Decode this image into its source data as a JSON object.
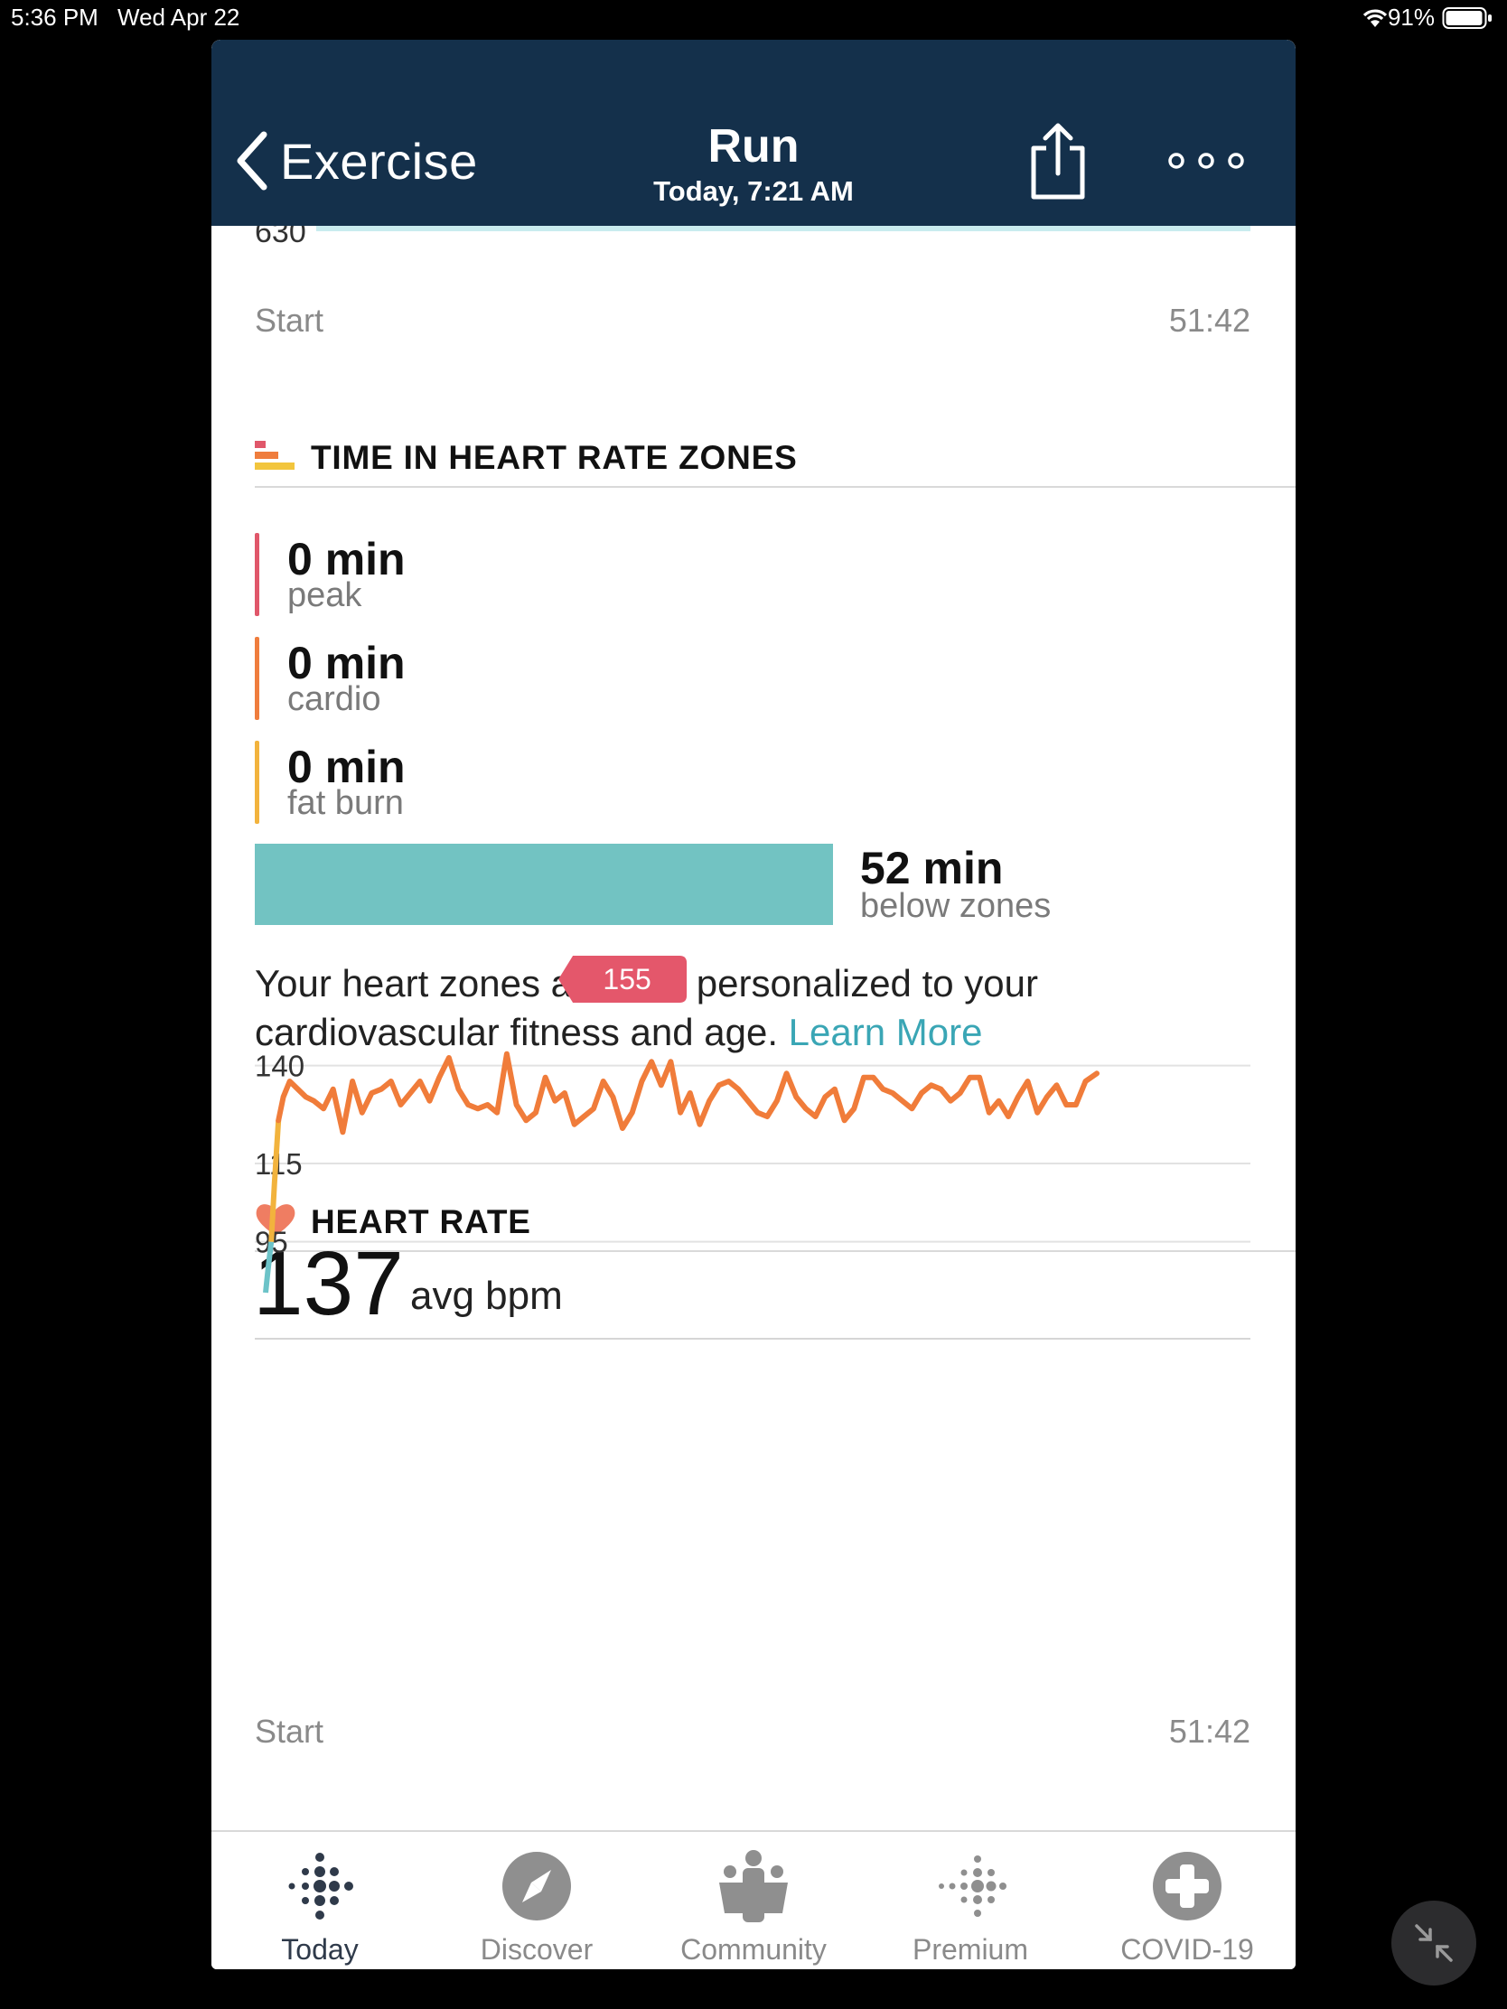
{
  "status_bar": {
    "time": "5:36 PM",
    "date": "Wed Apr 22",
    "battery": "91%"
  },
  "header": {
    "back_label": "Exercise",
    "title": "Run",
    "subtitle": "Today, 7:21 AM"
  },
  "top_chart": {
    "y_label": "630",
    "x_start": "Start",
    "x_end": "51:42"
  },
  "zones_section": {
    "title": "TIME IN HEART RATE ZONES",
    "zones": [
      {
        "value": "0 min",
        "label": "peak",
        "color": "#e0576a"
      },
      {
        "value": "0 min",
        "label": "cardio",
        "color": "#ef7d3d"
      },
      {
        "value": "0 min",
        "label": "fat burn",
        "color": "#f2b33d"
      }
    ],
    "below": {
      "value": "52 min",
      "label": "below zones",
      "color": "#72c3c2"
    },
    "note": "Your heart zones are now personalized to your cardiovascular fitness and age.",
    "learn_more": "Learn More"
  },
  "heart_rate_section": {
    "title": "HEART RATE",
    "avg_value": "137",
    "avg_unit": "avg bpm"
  },
  "chart_data": {
    "type": "line",
    "y_ticks": [
      140,
      115,
      95
    ],
    "ylim": [
      70,
      160
    ],
    "xlim": [
      0,
      51.7
    ],
    "x_start_label": "Start",
    "x_end_label": "51:42",
    "peak_label": "155",
    "peak_x": 19.0,
    "series": [
      {
        "x": [
          0,
          0.15,
          0.35,
          0.55,
          0.8,
          1.1,
          1.5,
          2.0,
          2.5,
          3.0,
          3.6,
          4.2,
          4.8,
          5.4,
          6.0,
          6.6,
          7.2,
          7.8,
          8.4,
          9.0,
          9.6,
          10.2,
          10.8,
          11.4,
          12.0,
          12.6,
          13.2,
          13.8,
          14.4,
          15.0,
          15.6,
          16.2,
          16.8,
          17.4,
          18.0,
          18.6,
          19.2,
          19.8,
          20.4,
          21.0,
          21.6,
          22.2,
          22.8,
          23.4,
          24.0,
          24.6,
          25.2,
          25.8,
          26.4,
          27.0,
          27.6,
          28.2,
          28.8,
          29.4,
          30.0,
          30.6,
          31.2,
          31.8,
          32.4,
          33.0,
          33.6,
          34.2,
          34.8,
          35.4,
          36.0,
          36.6,
          37.2,
          37.8,
          38.4,
          39.0,
          39.6,
          40.2,
          40.8,
          41.4,
          42.0,
          42.6,
          43.2,
          43.8,
          44.4,
          45.0,
          45.6,
          46.2,
          46.8,
          47.4,
          48.0,
          48.6,
          49.2,
          49.8,
          50.4,
          51.0,
          51.7
        ],
        "y": [
          82,
          88,
          95,
          110,
          126,
          132,
          136,
          134,
          132,
          131,
          129,
          134,
          123,
          136,
          128,
          133,
          134,
          136,
          130,
          133,
          136,
          131,
          137,
          142,
          134,
          130,
          129,
          130,
          128,
          143,
          130,
          126,
          128,
          137,
          131,
          133,
          125,
          127,
          129,
          136,
          132,
          124,
          128,
          136,
          141,
          135,
          141,
          128,
          133,
          125,
          131,
          135,
          136,
          134,
          131,
          128,
          127,
          131,
          138,
          132,
          129,
          127,
          132,
          134,
          126,
          129,
          137,
          137,
          134,
          133,
          131,
          129,
          133,
          135,
          134,
          131,
          133,
          137,
          137,
          128,
          131,
          127,
          132,
          136,
          128,
          132,
          135,
          130,
          130,
          136,
          138
        ]
      }
    ]
  },
  "tabs": [
    {
      "label": "Today",
      "icon": "fitbit-dots-icon",
      "active": true
    },
    {
      "label": "Discover",
      "icon": "compass-icon",
      "active": false
    },
    {
      "label": "Community",
      "icon": "community-people-icon",
      "active": false
    },
    {
      "label": "Premium",
      "icon": "premium-dots-icon",
      "active": false
    },
    {
      "label": "COVID-19",
      "icon": "medical-cross-icon",
      "active": false
    }
  ]
}
